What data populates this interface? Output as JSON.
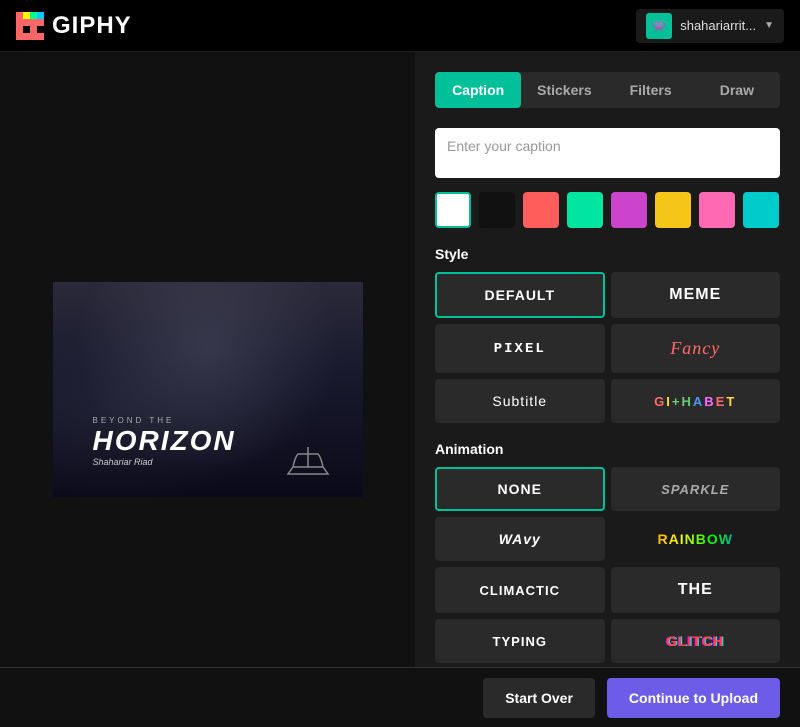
{
  "header": {
    "logo_text": "GIPHY",
    "user_name": "shahariarrit...",
    "user_avatar_emoji": "👾"
  },
  "tabs": {
    "items": [
      {
        "label": "Caption",
        "active": true
      },
      {
        "label": "Stickers",
        "active": false
      },
      {
        "label": "Filters",
        "active": false
      },
      {
        "label": "Draw",
        "active": false
      }
    ]
  },
  "caption": {
    "placeholder": "Enter your caption"
  },
  "colors": [
    {
      "hex": "#ffffff",
      "selected": true
    },
    {
      "hex": "#111111"
    },
    {
      "hex": "#ff5c5c"
    },
    {
      "hex": "#00e5a0"
    },
    {
      "hex": "#cc44cc"
    },
    {
      "hex": "#f5c518"
    },
    {
      "hex": "#ff69b4"
    },
    {
      "hex": "#00cccc"
    }
  ],
  "style": {
    "label": "Style",
    "items": [
      {
        "id": "default",
        "label": "DEFAULT",
        "active": true
      },
      {
        "id": "meme",
        "label": "MEME"
      },
      {
        "id": "pixel",
        "label": "PIXEL"
      },
      {
        "id": "fancy",
        "label": "Fancy"
      },
      {
        "id": "subtitle",
        "label": "Subtitle"
      },
      {
        "id": "alphabet",
        "label": "GIPHABET"
      }
    ]
  },
  "animation": {
    "label": "Animation",
    "items": [
      {
        "id": "none",
        "label": "NONE",
        "active": true
      },
      {
        "id": "sparkle",
        "label": "SPARKLE"
      },
      {
        "id": "wavy",
        "label": "WAvy"
      },
      {
        "id": "rainbow",
        "label": "RAINBOW"
      },
      {
        "id": "climactic",
        "label": "CLIMACTIC"
      },
      {
        "id": "the",
        "label": "THE"
      },
      {
        "id": "typing",
        "label": "TYPING"
      },
      {
        "id": "glitch",
        "label": "GLITCH"
      }
    ]
  },
  "footer": {
    "start_over": "Start Over",
    "continue": "Continue to Upload"
  },
  "preview": {
    "beyond": "BEYOND THE",
    "title": "HORIZON",
    "sub": "Shahariar Riad"
  }
}
